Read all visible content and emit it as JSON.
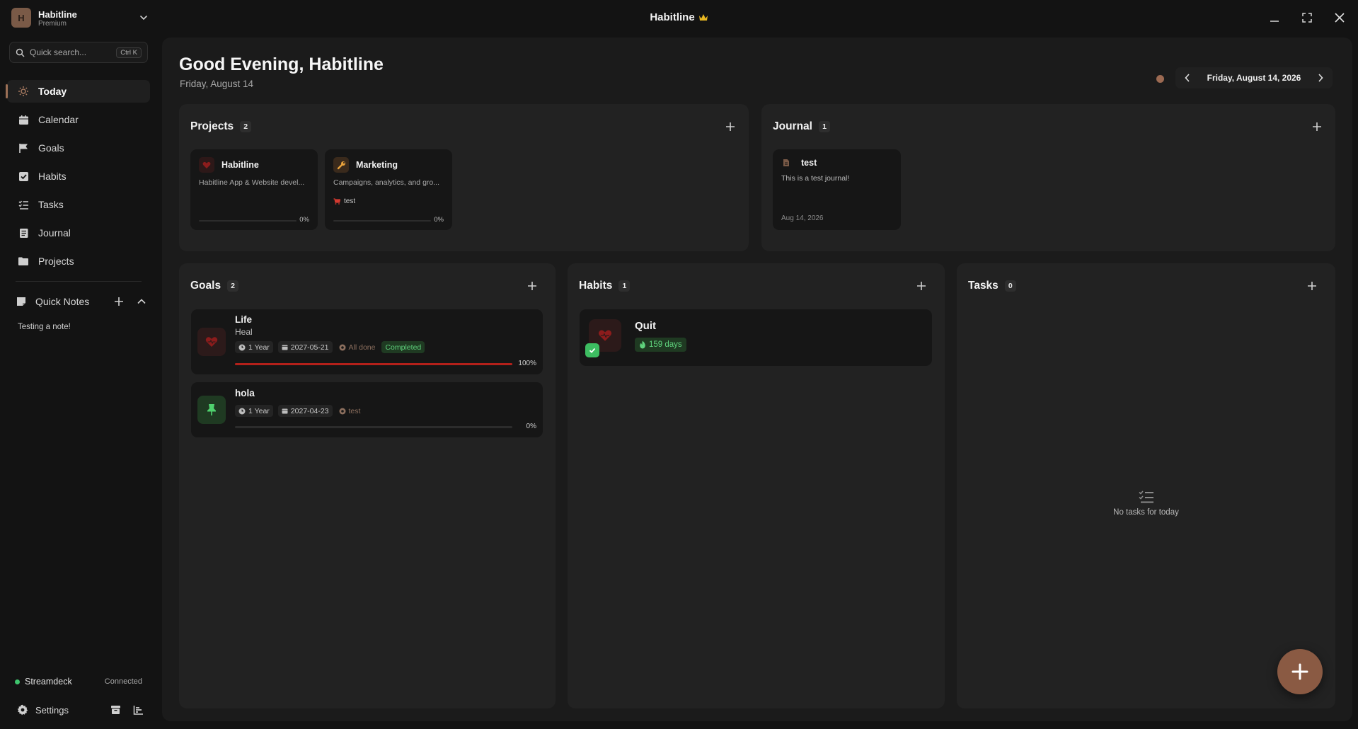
{
  "app": {
    "name": "Habitline",
    "plan": "Premium",
    "badge_letter": "H",
    "window_title": "Habitline"
  },
  "colors": {
    "accent": "#8a5a43",
    "success": "#3ec46d",
    "progress_red": "#b3201a",
    "panel_bg": "#222222",
    "card_bg": "#161616"
  },
  "search": {
    "placeholder": "Quick search...",
    "shortcut": "Ctrl K"
  },
  "sidebar": {
    "items": [
      {
        "label": "Today",
        "icon": "sun-icon",
        "active": true
      },
      {
        "label": "Calendar",
        "icon": "calendar-icon"
      },
      {
        "label": "Goals",
        "icon": "flag-icon"
      },
      {
        "label": "Habits",
        "icon": "checkbox-icon"
      },
      {
        "label": "Tasks",
        "icon": "list-check-icon"
      },
      {
        "label": "Journal",
        "icon": "book-icon"
      },
      {
        "label": "Projects",
        "icon": "folder-icon"
      }
    ],
    "quick_notes": {
      "label": "Quick Notes",
      "notes": [
        "Testing a note!"
      ]
    },
    "streamdeck": {
      "label": "Streamdeck",
      "status": "Connected"
    },
    "settings_label": "Settings"
  },
  "header": {
    "greeting": "Good Evening, Habitline",
    "date": "Friday, August 14",
    "date_nav": "Friday, August 14, 2026"
  },
  "projects": {
    "title": "Projects",
    "count": "2",
    "items": [
      {
        "name": "Habitline",
        "description": "Habitline App & Website devel...",
        "progress_label": "0%",
        "progress": 0,
        "icon": "heart-icon"
      },
      {
        "name": "Marketing",
        "description": "Campaigns, analytics, and gro...",
        "tag": "test",
        "progress_label": "0%",
        "progress": 0,
        "icon": "wrench-icon"
      }
    ]
  },
  "journal": {
    "title": "Journal",
    "count": "1",
    "items": [
      {
        "title": "test",
        "text": "This is a test journal!",
        "date": "Aug 14, 2026"
      }
    ]
  },
  "goals": {
    "title": "Goals",
    "count": "2",
    "items": [
      {
        "title": "Life",
        "subtitle": "Heal",
        "duration": "1 Year",
        "due": "2027-05-21",
        "milestone": "All done",
        "status": "Completed",
        "progress_label": "100%",
        "progress": 1.0,
        "icon": "heart-icon"
      },
      {
        "title": "hola",
        "duration": "1 Year",
        "due": "2027-04-23",
        "milestone": "test",
        "progress_label": "0%",
        "progress": 0,
        "icon": "pin-icon"
      }
    ]
  },
  "habits": {
    "title": "Habits",
    "count": "1",
    "items": [
      {
        "title": "Quit",
        "streak": "159 days",
        "done": true,
        "icon": "heart-icon"
      }
    ]
  },
  "tasks": {
    "title": "Tasks",
    "count": "0",
    "empty_text": "No tasks for today"
  }
}
